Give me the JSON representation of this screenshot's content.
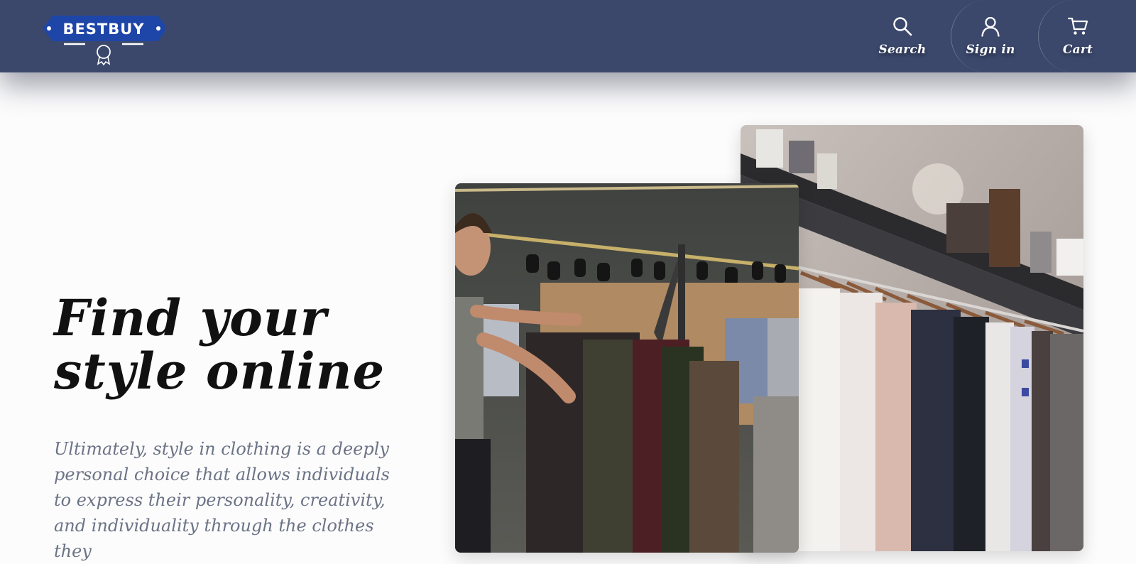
{
  "navbar": {
    "logo_text": "BESTBUY",
    "items": [
      {
        "label": "Search",
        "icon": "search-icon"
      },
      {
        "label": "Sign in",
        "icon": "user-icon"
      },
      {
        "label": "Cart",
        "icon": "cart-icon"
      }
    ]
  },
  "hero": {
    "title_line1": "Find your",
    "title_line2": "style online",
    "description": "Ultimately, style in clothing is a deeply personal choice that allows individuals to express their personality, creativity, and individuality through the clothes they",
    "images": [
      {
        "subject": "clothing store rack with shirts"
      },
      {
        "subject": "man browsing jackets on clothing rack"
      }
    ]
  },
  "colors": {
    "navbar_bg": "#3b486c",
    "logo_bg": "#1e46a8",
    "text_dark": "#111111",
    "text_muted": "#6b7386"
  }
}
